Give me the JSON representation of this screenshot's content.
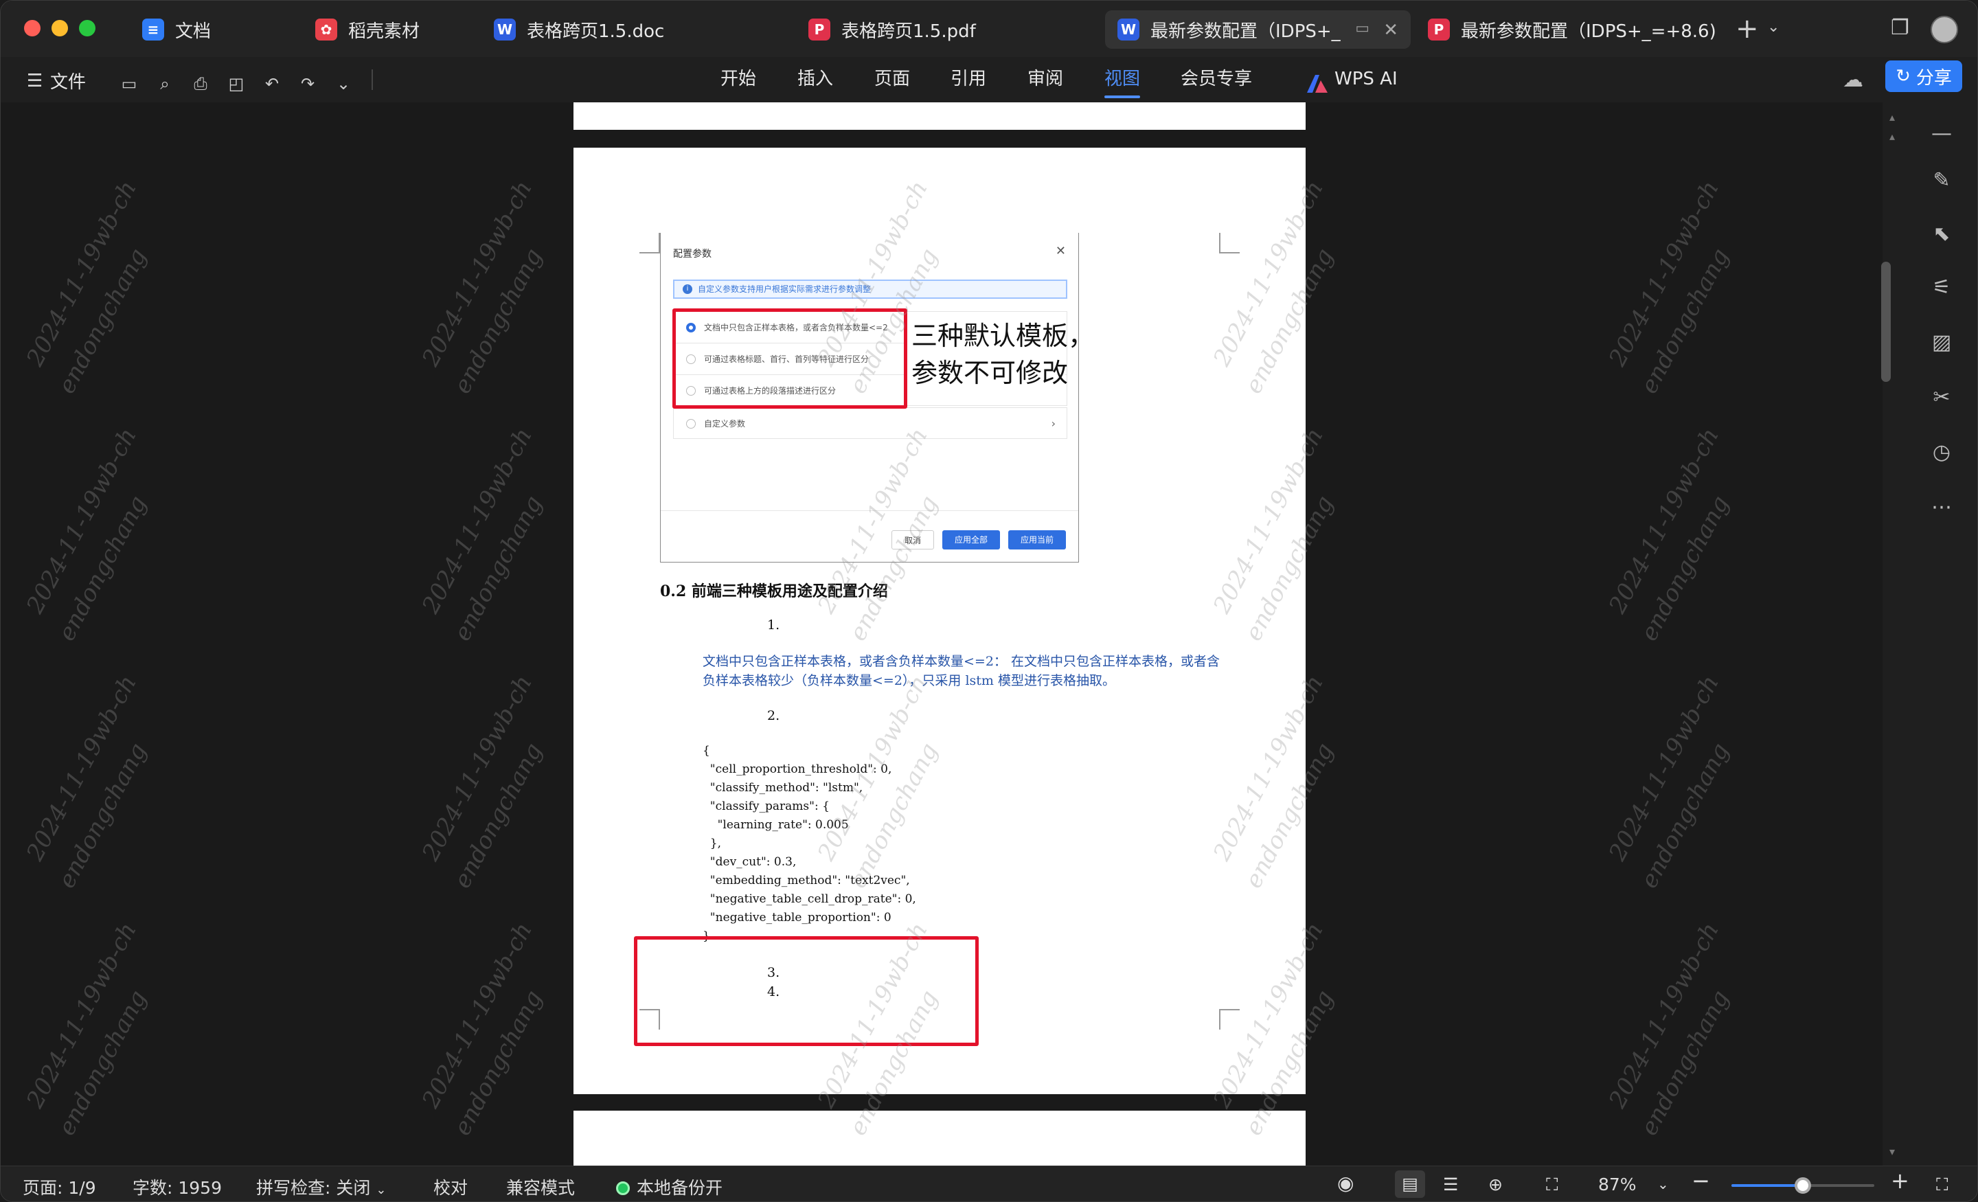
{
  "tabs": [
    {
      "label": "文档",
      "icon": "docs-app-icon",
      "color": "#2f7cf6"
    },
    {
      "label": "稻壳素材",
      "icon": "daoke-icon",
      "color": "#e8424b"
    },
    {
      "label": "表格跨页1.5.doc",
      "icon": "word-doc-icon",
      "color": "#2f5fe0"
    },
    {
      "label": "表格跨页1.5.pdf",
      "icon": "pdf-doc-icon",
      "color": "#e0314b"
    },
    {
      "label": "最新参数配置（IDPS+_",
      "icon": "word-doc-icon",
      "color": "#2f5fe0"
    },
    {
      "label": "最新参数配置（IDPS+_=+8.6)",
      "icon": "pdf-doc-icon",
      "color": "#e0314b"
    }
  ],
  "toolbar": {
    "file_label": "文件",
    "menu": [
      "开始",
      "插入",
      "页面",
      "引用",
      "审阅",
      "视图",
      "会员专享",
      "WPS AI"
    ],
    "active_menu": "视图",
    "share_label": "分享"
  },
  "document": {
    "embedded_dialog": {
      "title": "配置参数",
      "info": "自定义参数支持用户根据实际需求进行参数调整",
      "options": [
        "文档中只包含正样本表格，或者含负样本数量<=2",
        "可通过表格标题、首行、首列等特征进行区分",
        "可通过表格上方的段落描述进行区分",
        "自定义参数"
      ],
      "buttons": [
        "取消",
        "应用全部",
        "应用当前"
      ]
    },
    "callout_line1": "三种默认模板，",
    "callout_line2": "参数不可修改",
    "heading": "0.2 前端三种模板用途及配置介绍",
    "item1": "1.",
    "item1_text": "文档中只包含正样本表格，或者含负样本数量<=2： 在文档中只包含正样本表格，或者含负样本表格较少（负样本数量<=2），只采用 lstm 模型进行表格抽取。",
    "item2": "2.",
    "code": [
      "{",
      "  \"cell_proportion_threshold\": 0,",
      "  \"classify_method\": \"lstm\",",
      "  \"classify_params\": {",
      "    \"learning_rate\": 0.005",
      "  },",
      "  \"dev_cut\": 0.3,",
      "  \"embedding_method\": \"text2vec\",",
      "  \"negative_table_cell_drop_rate\": 0,",
      "  \"negative_table_proportion\": 0",
      "}"
    ],
    "item3": "3.",
    "item4": "4."
  },
  "watermark": {
    "line1": "2024-11-19wb-ch",
    "line2": "endongchang"
  },
  "status": {
    "page": "页面: 1/9",
    "words": "字数: 1959",
    "spell": "拼写检查: 关闭",
    "proof": "校对",
    "compat": "兼容模式",
    "backup": "本地备份开",
    "zoom": "87%",
    "zoom_level": 0.5
  }
}
